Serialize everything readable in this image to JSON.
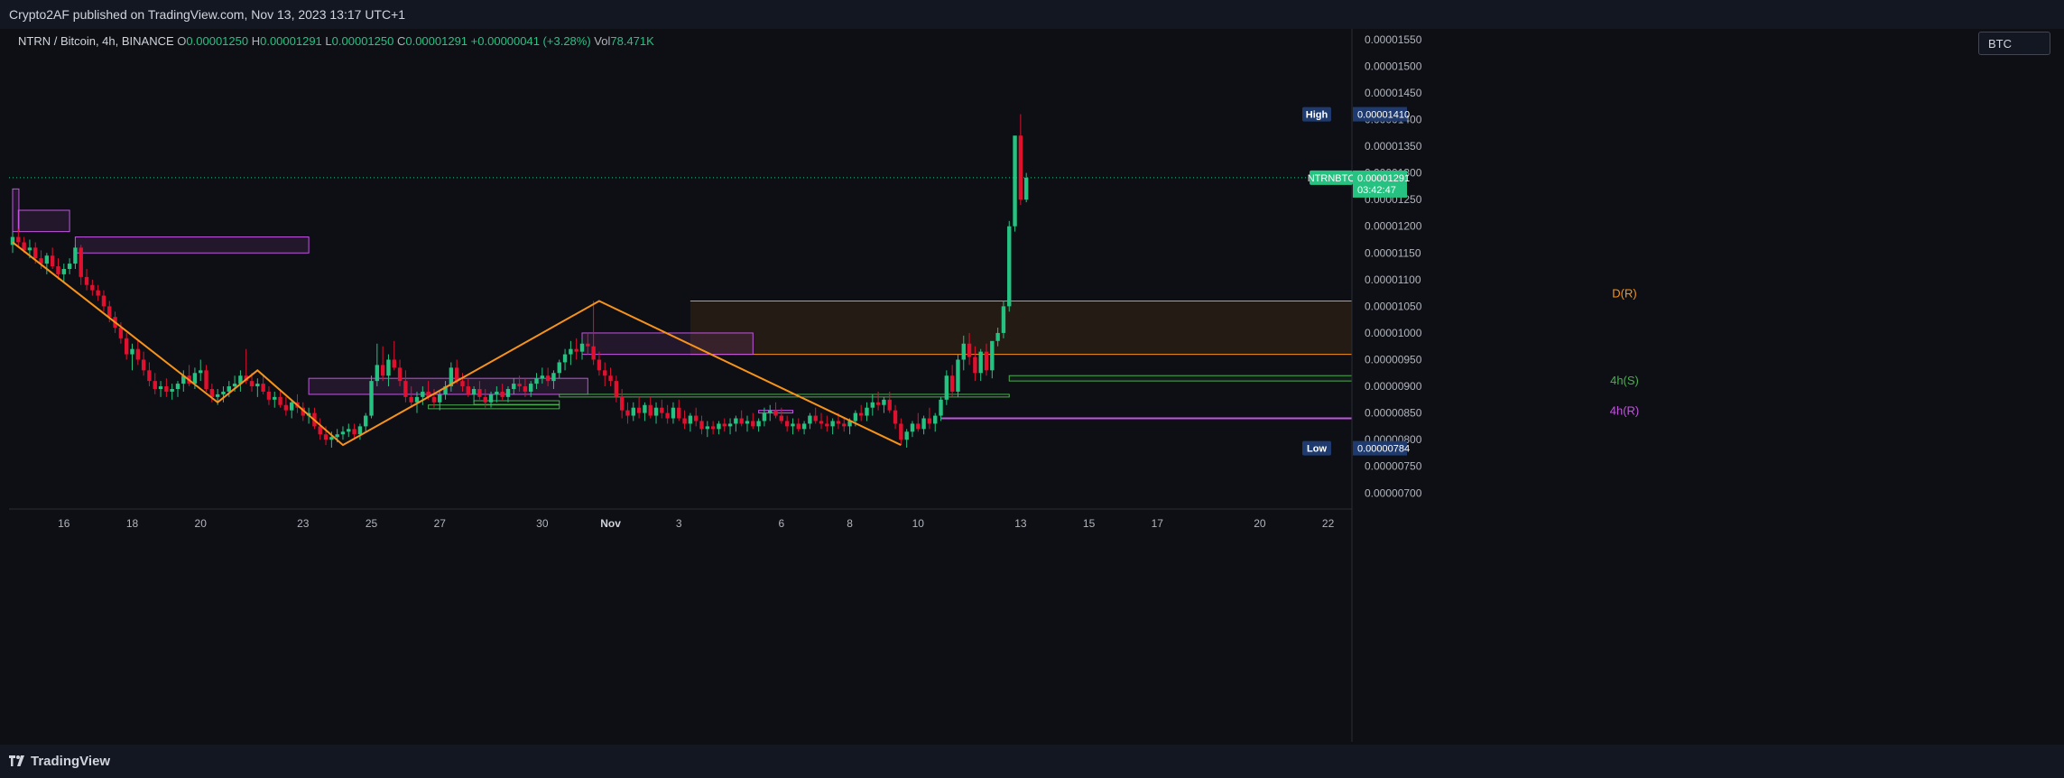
{
  "header": {
    "published": "Crypto2AF published on TradingView.com, Nov 13, 2023 13:17 UTC+1"
  },
  "legend": {
    "symbol": "NTRN / Bitcoin, 4h, BINANCE",
    "o_label": "O",
    "o_value": "0.00001250",
    "h_label": "H",
    "h_value": "0.00001291",
    "l_label": "L",
    "l_value": "0.00001250",
    "c_label": "C",
    "c_value": "0.00001291",
    "change": "+0.00000041 (+3.28%)",
    "vol_label": "Vol",
    "vol_value": "78.471K"
  },
  "currency": "BTC",
  "footer": {
    "brand": "TradingView"
  },
  "colors": {
    "up": "#26c281",
    "down": "#e0102f",
    "orange": "#f7931a",
    "purple": "#c255e0",
    "green_zone": "#4caf50"
  },
  "chart_data": {
    "type": "candlestick",
    "symbol": "NTRNBTC",
    "ylim": [
      6.7e-06,
      1.57e-05
    ],
    "y_ticks": [
      "0.00000700",
      "0.00000750",
      "0.00000800",
      "0.00000850",
      "0.00000900",
      "0.00000950",
      "0.00001000",
      "0.00001050",
      "0.00001100",
      "0.00001150",
      "0.00001200",
      "0.00001250",
      "0.00001300",
      "0.00001350",
      "0.00001400",
      "0.00001450",
      "0.00001500",
      "0.00001550"
    ],
    "x_ticks": [
      {
        "label": "16",
        "t": 9
      },
      {
        "label": "18",
        "t": 21
      },
      {
        "label": "20",
        "t": 33
      },
      {
        "label": "23",
        "t": 51
      },
      {
        "label": "25",
        "t": 63
      },
      {
        "label": "27",
        "t": 75
      },
      {
        "label": "30",
        "t": 93
      },
      {
        "label": "Nov",
        "t": 105
      },
      {
        "label": "3",
        "t": 117
      },
      {
        "label": "6",
        "t": 135
      },
      {
        "label": "8",
        "t": 147
      },
      {
        "label": "10",
        "t": 159
      },
      {
        "label": "13",
        "t": 177
      },
      {
        "label": "15",
        "t": 189
      },
      {
        "label": "17",
        "t": 201
      },
      {
        "label": "20",
        "t": 219
      },
      {
        "label": "22",
        "t": 231
      }
    ],
    "price_labels": {
      "high_label": "High",
      "high_value": "0.00001410",
      "low_label": "Low",
      "low_value": "0.00000784",
      "last_symbol": "NTRNBTC",
      "last_value": "0.00001291",
      "countdown": "03:42:47"
    },
    "last_price": 1.291e-05,
    "zone_labels": {
      "daily": "D(R)",
      "h4_support": "4h(S)",
      "h4_resistance": "4h(R)"
    },
    "zones": {
      "daily_resistance": [
        9.6e-06,
        1.06e-05
      ],
      "h4_support": [
        9.1e-06,
        9.2e-06
      ],
      "h4_resistance": 8.4e-06
    },
    "pattern_points": [
      [
        0,
        1.17e-05
      ],
      [
        36,
        8.7e-06
      ],
      [
        43,
        9.3e-06
      ],
      [
        58,
        7.9e-06
      ],
      [
        103,
        1.06e-05
      ],
      [
        156,
        7.9e-06
      ]
    ],
    "candles": [
      [
        0,
        1.165,
        1.19,
        1.15,
        1.18
      ],
      [
        1,
        1.18,
        1.195,
        1.16,
        1.17
      ],
      [
        2,
        1.17,
        1.18,
        1.15,
        1.155
      ],
      [
        3,
        1.155,
        1.175,
        1.14,
        1.16
      ],
      [
        4,
        1.16,
        1.17,
        1.13,
        1.14
      ],
      [
        5,
        1.14,
        1.155,
        1.12,
        1.13
      ],
      [
        6,
        1.13,
        1.15,
        1.11,
        1.145
      ],
      [
        7,
        1.145,
        1.16,
        1.12,
        1.125
      ],
      [
        8,
        1.125,
        1.14,
        1.1,
        1.11
      ],
      [
        9,
        1.11,
        1.13,
        1.095,
        1.12
      ],
      [
        10,
        1.12,
        1.14,
        1.11,
        1.13
      ],
      [
        11,
        1.13,
        1.165,
        1.12,
        1.16
      ],
      [
        12,
        1.16,
        1.165,
        1.09,
        1.105
      ],
      [
        13,
        1.105,
        1.12,
        1.08,
        1.09
      ],
      [
        14,
        1.09,
        1.1,
        1.07,
        1.08
      ],
      [
        15,
        1.08,
        1.09,
        1.06,
        1.07
      ],
      [
        16,
        1.07,
        1.08,
        1.04,
        1.05
      ],
      [
        17,
        1.05,
        1.06,
        1.02,
        1.03
      ],
      [
        18,
        1.03,
        1.04,
        1.0,
        1.01
      ],
      [
        19,
        1.01,
        1.02,
        0.98,
        0.99
      ],
      [
        20,
        0.99,
        1.0,
        0.95,
        0.96
      ],
      [
        21,
        0.96,
        0.98,
        0.93,
        0.97
      ],
      [
        22,
        0.97,
        0.985,
        0.94,
        0.95
      ],
      [
        23,
        0.95,
        0.965,
        0.92,
        0.93
      ],
      [
        24,
        0.93,
        0.945,
        0.9,
        0.91
      ],
      [
        25,
        0.91,
        0.925,
        0.885,
        0.895
      ],
      [
        26,
        0.895,
        0.91,
        0.88,
        0.9
      ],
      [
        27,
        0.9,
        0.915,
        0.88,
        0.89
      ],
      [
        28,
        0.89,
        0.905,
        0.875,
        0.895
      ],
      [
        29,
        0.895,
        0.91,
        0.88,
        0.905
      ],
      [
        30,
        0.905,
        0.93,
        0.89,
        0.92
      ],
      [
        31,
        0.92,
        0.94,
        0.9,
        0.905
      ],
      [
        32,
        0.905,
        0.935,
        0.895,
        0.925
      ],
      [
        33,
        0.925,
        0.95,
        0.91,
        0.93
      ],
      [
        34,
        0.93,
        0.94,
        0.89,
        0.895
      ],
      [
        35,
        0.895,
        0.905,
        0.87,
        0.88
      ],
      [
        36,
        0.88,
        0.895,
        0.865,
        0.885
      ],
      [
        37,
        0.885,
        0.9,
        0.87,
        0.89
      ],
      [
        38,
        0.89,
        0.91,
        0.88,
        0.9
      ],
      [
        39,
        0.9,
        0.92,
        0.89,
        0.905
      ],
      [
        40,
        0.905,
        0.93,
        0.89,
        0.92
      ],
      [
        41,
        0.92,
        0.97,
        0.905,
        0.91
      ],
      [
        42,
        0.91,
        0.925,
        0.89,
        0.9
      ],
      [
        43,
        0.9,
        0.915,
        0.88,
        0.905
      ],
      [
        44,
        0.905,
        0.92,
        0.885,
        0.89
      ],
      [
        45,
        0.89,
        0.9,
        0.865,
        0.875
      ],
      [
        46,
        0.875,
        0.89,
        0.86,
        0.88
      ],
      [
        47,
        0.88,
        0.895,
        0.86,
        0.865
      ],
      [
        48,
        0.865,
        0.88,
        0.845,
        0.855
      ],
      [
        49,
        0.855,
        0.875,
        0.84,
        0.87
      ],
      [
        50,
        0.87,
        0.885,
        0.85,
        0.86
      ],
      [
        51,
        0.86,
        0.87,
        0.835,
        0.845
      ],
      [
        52,
        0.845,
        0.86,
        0.83,
        0.85
      ],
      [
        53,
        0.85,
        0.86,
        0.82,
        0.825
      ],
      [
        54,
        0.825,
        0.84,
        0.8,
        0.81
      ],
      [
        55,
        0.81,
        0.825,
        0.79,
        0.8
      ],
      [
        56,
        0.8,
        0.815,
        0.785,
        0.805
      ],
      [
        57,
        0.805,
        0.82,
        0.795,
        0.81
      ],
      [
        58,
        0.81,
        0.825,
        0.8,
        0.815
      ],
      [
        59,
        0.815,
        0.83,
        0.805,
        0.82
      ],
      [
        60,
        0.82,
        0.83,
        0.8,
        0.81
      ],
      [
        61,
        0.81,
        0.83,
        0.8,
        0.825
      ],
      [
        62,
        0.825,
        0.85,
        0.815,
        0.845
      ],
      [
        63,
        0.845,
        0.92,
        0.84,
        0.91
      ],
      [
        64,
        0.91,
        0.98,
        0.9,
        0.94
      ],
      [
        65,
        0.94,
        0.975,
        0.91,
        0.92
      ],
      [
        66,
        0.92,
        0.96,
        0.9,
        0.95
      ],
      [
        67,
        0.95,
        0.985,
        0.93,
        0.935
      ],
      [
        68,
        0.935,
        0.95,
        0.9,
        0.91
      ],
      [
        69,
        0.91,
        0.93,
        0.87,
        0.88
      ],
      [
        70,
        0.88,
        0.9,
        0.86,
        0.87
      ],
      [
        71,
        0.87,
        0.89,
        0.85,
        0.88
      ],
      [
        72,
        0.88,
        0.9,
        0.865,
        0.89
      ],
      [
        73,
        0.89,
        0.91,
        0.875,
        0.88
      ],
      [
        74,
        0.88,
        0.895,
        0.86,
        0.87
      ],
      [
        75,
        0.87,
        0.89,
        0.855,
        0.885
      ],
      [
        76,
        0.885,
        0.91,
        0.875,
        0.9
      ],
      [
        77,
        0.9,
        0.945,
        0.89,
        0.935
      ],
      [
        78,
        0.935,
        0.95,
        0.905,
        0.91
      ],
      [
        79,
        0.91,
        0.925,
        0.89,
        0.9
      ],
      [
        80,
        0.9,
        0.915,
        0.88,
        0.885
      ],
      [
        81,
        0.885,
        0.9,
        0.87,
        0.895
      ],
      [
        82,
        0.895,
        0.91,
        0.875,
        0.88
      ],
      [
        83,
        0.88,
        0.895,
        0.86,
        0.87
      ],
      [
        84,
        0.87,
        0.89,
        0.86,
        0.885
      ],
      [
        85,
        0.885,
        0.9,
        0.87,
        0.89
      ],
      [
        86,
        0.89,
        0.905,
        0.875,
        0.88
      ],
      [
        87,
        0.88,
        0.9,
        0.87,
        0.895
      ],
      [
        88,
        0.895,
        0.915,
        0.885,
        0.905
      ],
      [
        89,
        0.905,
        0.92,
        0.89,
        0.9
      ],
      [
        90,
        0.9,
        0.915,
        0.88,
        0.89
      ],
      [
        91,
        0.89,
        0.91,
        0.88,
        0.905
      ],
      [
        92,
        0.905,
        0.925,
        0.895,
        0.915
      ],
      [
        93,
        0.915,
        0.935,
        0.905,
        0.92
      ],
      [
        94,
        0.92,
        0.935,
        0.9,
        0.91
      ],
      [
        95,
        0.91,
        0.93,
        0.895,
        0.925
      ],
      [
        96,
        0.925,
        0.95,
        0.915,
        0.945
      ],
      [
        97,
        0.945,
        0.97,
        0.93,
        0.96
      ],
      [
        98,
        0.96,
        0.985,
        0.94,
        0.97
      ],
      [
        99,
        0.97,
        0.99,
        0.95,
        0.965
      ],
      [
        100,
        0.965,
        0.99,
        0.95,
        0.98
      ],
      [
        101,
        0.98,
        1.0,
        0.96,
        0.975
      ],
      [
        102,
        0.975,
        1.06,
        0.94,
        0.95
      ],
      [
        103,
        0.95,
        0.965,
        0.92,
        0.93
      ],
      [
        104,
        0.93,
        0.945,
        0.9,
        0.92
      ],
      [
        105,
        0.92,
        0.935,
        0.9,
        0.91
      ],
      [
        106,
        0.91,
        0.92,
        0.87,
        0.88
      ],
      [
        107,
        0.88,
        0.895,
        0.84,
        0.855
      ],
      [
        108,
        0.855,
        0.87,
        0.83,
        0.845
      ],
      [
        109,
        0.845,
        0.87,
        0.835,
        0.86
      ],
      [
        110,
        0.86,
        0.88,
        0.84,
        0.85
      ],
      [
        111,
        0.85,
        0.87,
        0.835,
        0.865
      ],
      [
        112,
        0.865,
        0.88,
        0.84,
        0.845
      ],
      [
        113,
        0.845,
        0.87,
        0.83,
        0.86
      ],
      [
        114,
        0.86,
        0.875,
        0.84,
        0.85
      ],
      [
        115,
        0.85,
        0.865,
        0.83,
        0.84
      ],
      [
        116,
        0.84,
        0.87,
        0.83,
        0.86
      ],
      [
        117,
        0.86,
        0.875,
        0.835,
        0.84
      ],
      [
        118,
        0.84,
        0.855,
        0.82,
        0.83
      ],
      [
        119,
        0.83,
        0.85,
        0.815,
        0.845
      ],
      [
        120,
        0.845,
        0.86,
        0.825,
        0.835
      ],
      [
        121,
        0.835,
        0.845,
        0.81,
        0.82
      ],
      [
        122,
        0.82,
        0.835,
        0.805,
        0.825
      ],
      [
        123,
        0.825,
        0.835,
        0.81,
        0.82
      ],
      [
        124,
        0.82,
        0.835,
        0.81,
        0.83
      ],
      [
        125,
        0.83,
        0.84,
        0.815,
        0.825
      ],
      [
        126,
        0.825,
        0.84,
        0.81,
        0.83
      ],
      [
        127,
        0.83,
        0.845,
        0.815,
        0.84
      ],
      [
        128,
        0.84,
        0.855,
        0.825,
        0.83
      ],
      [
        129,
        0.83,
        0.845,
        0.815,
        0.835
      ],
      [
        130,
        0.835,
        0.85,
        0.82,
        0.825
      ],
      [
        131,
        0.825,
        0.84,
        0.815,
        0.835
      ],
      [
        132,
        0.835,
        0.86,
        0.825,
        0.85
      ],
      [
        133,
        0.85,
        0.865,
        0.835,
        0.855
      ],
      [
        134,
        0.855,
        0.87,
        0.84,
        0.845
      ],
      [
        135,
        0.845,
        0.86,
        0.83,
        0.835
      ],
      [
        136,
        0.835,
        0.845,
        0.815,
        0.825
      ],
      [
        137,
        0.825,
        0.84,
        0.81,
        0.83
      ],
      [
        138,
        0.83,
        0.84,
        0.815,
        0.82
      ],
      [
        139,
        0.82,
        0.835,
        0.81,
        0.83
      ],
      [
        140,
        0.83,
        0.85,
        0.82,
        0.845
      ],
      [
        141,
        0.845,
        0.86,
        0.83,
        0.835
      ],
      [
        142,
        0.835,
        0.85,
        0.82,
        0.83
      ],
      [
        143,
        0.83,
        0.845,
        0.815,
        0.825
      ],
      [
        144,
        0.825,
        0.84,
        0.81,
        0.835
      ],
      [
        145,
        0.835,
        0.85,
        0.82,
        0.83
      ],
      [
        146,
        0.83,
        0.84,
        0.815,
        0.825
      ],
      [
        147,
        0.825,
        0.84,
        0.81,
        0.835
      ],
      [
        148,
        0.835,
        0.855,
        0.825,
        0.85
      ],
      [
        149,
        0.85,
        0.865,
        0.835,
        0.845
      ],
      [
        150,
        0.845,
        0.87,
        0.835,
        0.86
      ],
      [
        151,
        0.86,
        0.885,
        0.845,
        0.87
      ],
      [
        152,
        0.87,
        0.89,
        0.855,
        0.865
      ],
      [
        153,
        0.865,
        0.88,
        0.85,
        0.875
      ],
      [
        154,
        0.875,
        0.89,
        0.85,
        0.855
      ],
      [
        155,
        0.855,
        0.865,
        0.82,
        0.83
      ],
      [
        156,
        0.83,
        0.84,
        0.79,
        0.8
      ],
      [
        157,
        0.8,
        0.82,
        0.785,
        0.815
      ],
      [
        158,
        0.815,
        0.835,
        0.805,
        0.83
      ],
      [
        159,
        0.83,
        0.85,
        0.815,
        0.82
      ],
      [
        160,
        0.82,
        0.845,
        0.81,
        0.84
      ],
      [
        161,
        0.84,
        0.86,
        0.82,
        0.83
      ],
      [
        162,
        0.83,
        0.85,
        0.815,
        0.845
      ],
      [
        163,
        0.845,
        0.88,
        0.835,
        0.875
      ],
      [
        164,
        0.875,
        0.93,
        0.865,
        0.92
      ],
      [
        165,
        0.92,
        0.94,
        0.88,
        0.89
      ],
      [
        166,
        0.89,
        0.96,
        0.88,
        0.95
      ],
      [
        167,
        0.95,
        0.995,
        0.93,
        0.98
      ],
      [
        168,
        0.98,
        1.0,
        0.94,
        0.955
      ],
      [
        169,
        0.955,
        0.975,
        0.91,
        0.925
      ],
      [
        170,
        0.925,
        0.97,
        0.91,
        0.965
      ],
      [
        171,
        0.965,
        0.98,
        0.92,
        0.93
      ],
      [
        172,
        0.93,
        0.96,
        0.915,
        0.985
      ],
      [
        173,
        0.985,
        1.01,
        0.975,
        1.0
      ],
      [
        174,
        1.0,
        1.06,
        0.99,
        1.05
      ],
      [
        175,
        1.05,
        1.21,
        1.04,
        1.2
      ],
      [
        176,
        1.2,
        1.265,
        1.19,
        1.37
      ],
      [
        177,
        1.37,
        1.41,
        1.24,
        1.25
      ],
      [
        178,
        1.25,
        1.3,
        1.245,
        1.291
      ]
    ]
  }
}
